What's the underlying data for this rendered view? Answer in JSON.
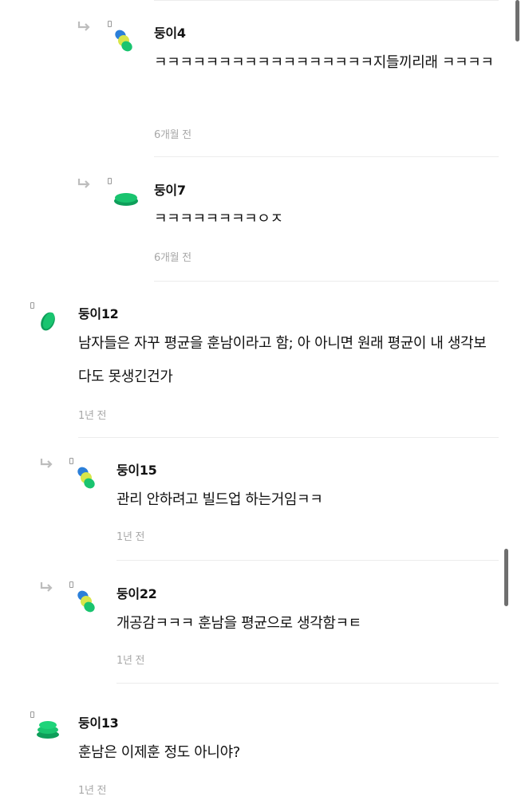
{
  "comments": [
    {
      "author": "둥이4",
      "text": "ㅋㅋㅋㅋㅋㅋㅋㅋㅋㅋㅋㅋㅋㅋㅋㅋㅋ지들끼리래 ㅋㅋㅋㅋ",
      "time": "6개월 전"
    },
    {
      "author": "둥이7",
      "text": "ㅋㅋㅋㅋㅋㅋㅋㅋㅇㅈ",
      "time": "6개월 전"
    },
    {
      "author": "둥이12",
      "text": "남자들은 자꾸 평균을 훈남이라고 함; 아 아니면 원래 평균이 내 생각보다도 못생긴건가",
      "time": "1년 전"
    },
    {
      "author": "둥이15",
      "text": "관리 안하려고 빌드업 하는거임ㅋㅋ",
      "time": "1년 전"
    },
    {
      "author": "둥이22",
      "text": "개공감ㅋㅋㅋ 훈남을 평균으로 생각함ㅋㅌ",
      "time": "1년 전"
    },
    {
      "author": "둥이13",
      "text": "훈남은 이제훈 정도 아니야?",
      "time": "1년 전"
    }
  ],
  "icons": {
    "reply": "reply-arrow-icon",
    "avatar": "green-blob-avatar-icon"
  },
  "colors": {
    "avatar_green": "#19c46f",
    "avatar_blue": "#2b7fd9",
    "avatar_yellow": "#d8e64a",
    "time_gray": "#a8a8a8"
  }
}
